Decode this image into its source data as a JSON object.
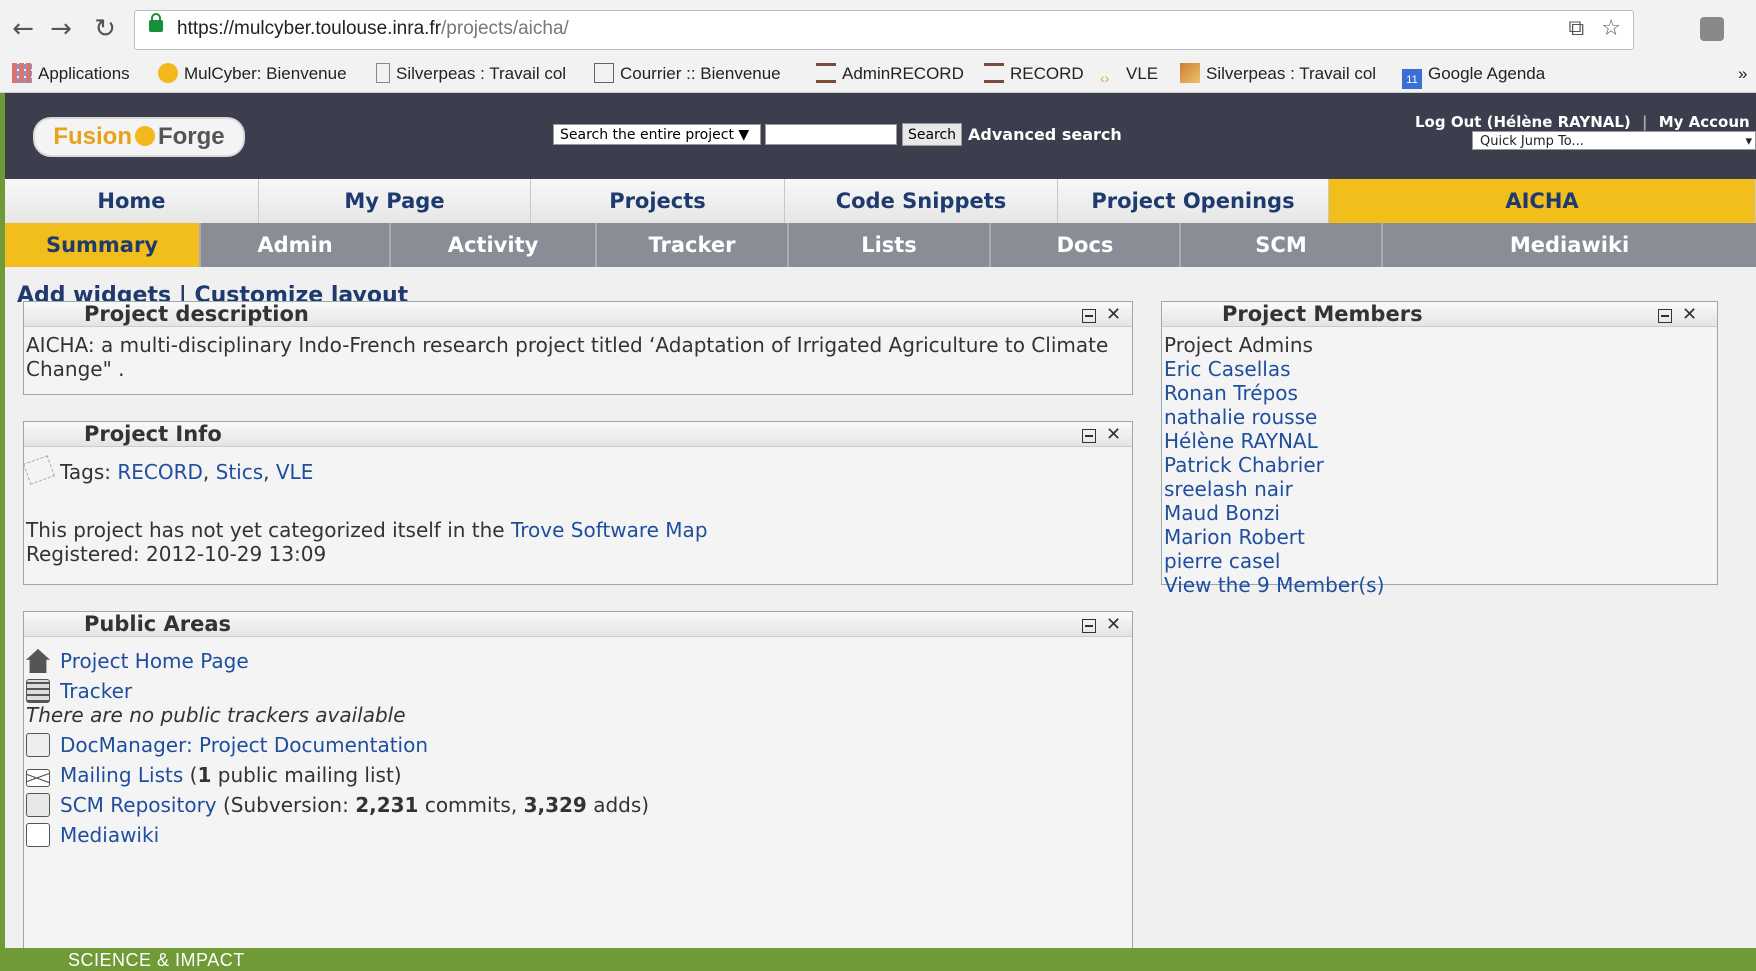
{
  "browser": {
    "nav": {
      "back": "←",
      "forward": "→",
      "reload": "↻"
    },
    "url_host": "https://mulcyber.toulouse.inra.fr",
    "url_path": "/projects/aicha/",
    "bookmarks": [
      {
        "label": "Applications",
        "icon": "apps-grid-icon",
        "color": "#d9534f"
      },
      {
        "label": "MulCyber: Bienvenue",
        "icon": "mulcyber-logo-icon",
        "color": "#f2b81c"
      },
      {
        "label": "Silverpeas : Travail col",
        "icon": "page-icon",
        "color": "#888888"
      },
      {
        "label": "Courrier :: Bienvenue",
        "icon": "mail-icon",
        "color": "#666666"
      },
      {
        "label": "AdminRECORD",
        "icon": "record-icon",
        "color": "#7a4b3a"
      },
      {
        "label": "RECORD",
        "icon": "record-icon",
        "color": "#7a4b3a"
      },
      {
        "label": "VLE",
        "icon": "vle-icon",
        "color": "#e8a23a"
      },
      {
        "label": "Silverpeas : Travail col",
        "icon": "silverpeas-icon",
        "color": "#c9822f"
      },
      {
        "label": "Google Agenda",
        "icon": "calendar-icon",
        "color": "#3b6fd8"
      }
    ],
    "bookmarks_more": "»"
  },
  "header": {
    "logo_left": "Fusion",
    "logo_right": "Forge",
    "search_scope": "Search the entire project ▼",
    "search_button": "Search",
    "advanced_search": "Advanced search",
    "logout": "Log Out (Hélène RAYNAL)",
    "my_account": "My Accoun",
    "quick_jump": "Quick Jump To..."
  },
  "tabs": [
    {
      "label": "Home",
      "active": false
    },
    {
      "label": "My Page",
      "active": false
    },
    {
      "label": "Projects",
      "active": false
    },
    {
      "label": "Code Snippets",
      "active": false
    },
    {
      "label": "Project Openings",
      "active": false
    },
    {
      "label": "AICHA",
      "active": true
    }
  ],
  "subtabs": [
    {
      "label": "Summary",
      "active": true
    },
    {
      "label": "Admin"
    },
    {
      "label": "Activity"
    },
    {
      "label": "Tracker"
    },
    {
      "label": "Lists"
    },
    {
      "label": "Docs"
    },
    {
      "label": "SCM"
    },
    {
      "label": "Mediawiki"
    }
  ],
  "layout_links": {
    "add_widgets": "Add widgets",
    "separator": "|",
    "customize": "Customize layout"
  },
  "widgets": {
    "description": {
      "title": "Project description",
      "text": "AICHA: a multi-disciplinary Indo-French research project titled ‘Adaptation of Irrigated Agriculture to Climate Change\" ."
    },
    "info": {
      "title": "Project Info",
      "tags_label": "Tags:",
      "tags": [
        "RECORD",
        "Stics",
        "VLE"
      ],
      "trove_text": "This project has not yet categorized itself in the",
      "trove_link": "Trove Software Map",
      "registered": "Registered: 2012-10-29 13:09"
    },
    "members": {
      "title": "Project Members",
      "admins_label": "Project Admins",
      "members": [
        "Eric Casellas",
        "Ronan Trépos",
        "nathalie rousse",
        "Hélène RAYNAL",
        "Patrick Chabrier",
        "sreelash nair",
        "Maud Bonzi",
        "Marion Robert",
        "pierre casel"
      ],
      "view_all": "View the 9 Member(s)"
    },
    "public_areas": {
      "title": "Public Areas",
      "home_page": "Project Home Page",
      "tracker": "Tracker",
      "no_trackers": "There are no public trackers available",
      "docmanager": "DocManager: Project Documentation",
      "mailing_lists": "Mailing Lists",
      "mailing_count": "1",
      "mailing_suffix": "public mailing list)",
      "scm_link": "SCM Repository",
      "scm_prefix": "(Subversion:",
      "scm_commits": "2,231",
      "scm_commits_label": "commits,",
      "scm_adds": "3,329",
      "scm_adds_label": "adds)",
      "mediawiki": "Mediawiki"
    },
    "controls": {
      "minimize": "⊟",
      "close": "✕"
    }
  },
  "footer": {
    "text": "SCIENCE & IMPACT"
  }
}
